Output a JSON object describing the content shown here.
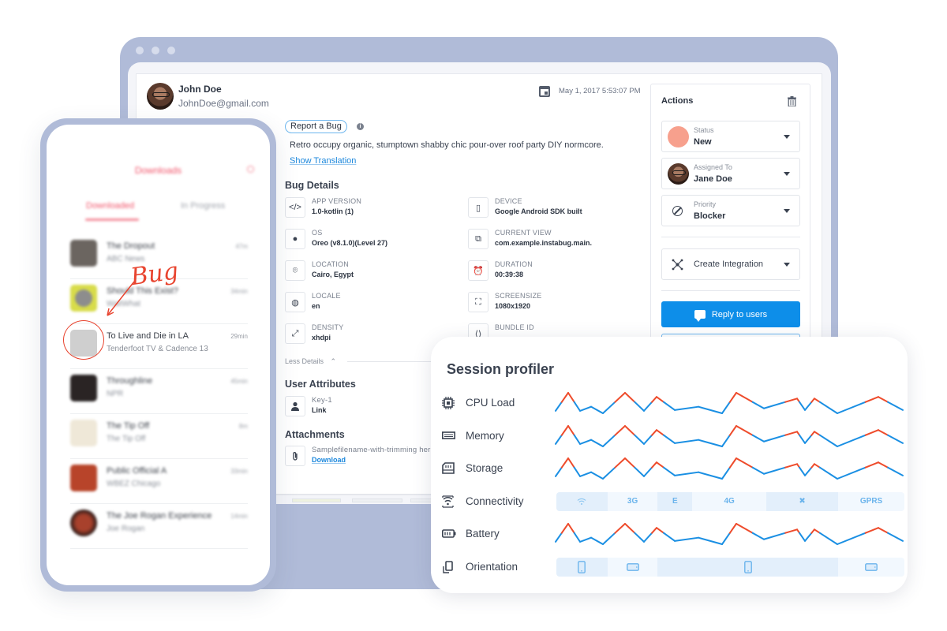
{
  "report": {
    "reporter_name": "John Doe",
    "reporter_email": "JohnDoe@gmail.com",
    "date": "May 1, 2017 5:53:07 PM",
    "category_badge": "Report a Bug",
    "info_glyph": "i",
    "description": "Retro occupy organic, stumptown shabby chic pour-over roof party DIY normcore.",
    "show_translation": "Show Translation"
  },
  "bug_details": {
    "title": "Bug Details",
    "items": [
      {
        "icon": "code-icon",
        "glyph": "</>",
        "label": "APP VERSION",
        "value": "1.0-kotlin (1)"
      },
      {
        "icon": "device-icon",
        "glyph": "▯",
        "label": "DEVICE",
        "value": "Google Android SDK built"
      },
      {
        "icon": "android-icon",
        "glyph": "●",
        "label": "OS",
        "value": "Oreo (v8.1.0)(Level 27)"
      },
      {
        "icon": "current-view-icon",
        "glyph": "⧉",
        "label": "CURRENT VIEW",
        "value": "com.example.instabug.main."
      },
      {
        "icon": "location-icon",
        "glyph": "⌾",
        "label": "LOCATION",
        "value": "Cairo, Egypt"
      },
      {
        "icon": "alarm-clock-icon",
        "glyph": "⏰",
        "label": "DURATION",
        "value": "00:39:38"
      },
      {
        "icon": "globe-icon",
        "glyph": "◍",
        "label": "LOCALE",
        "value": "en"
      },
      {
        "icon": "screensize-icon",
        "glyph": "⛶",
        "label": "SCREENSIZE",
        "value": "1080x1920"
      },
      {
        "icon": "density-icon",
        "glyph": "⤢",
        "label": "DENSITY",
        "value": "xhdpi"
      },
      {
        "icon": "bundle-icon",
        "glyph": "⟨⟩",
        "label": "BUNDLE ID",
        "value": ""
      }
    ],
    "less_details": "Less Details",
    "less_glyph": "⌃"
  },
  "user_attributes": {
    "title": "User Attributes",
    "items": [
      {
        "label": "Key-1",
        "value": "Link"
      }
    ]
  },
  "attachments": {
    "title": "Attachments",
    "items": [
      {
        "filename": "Samplefilename-with-trimming her",
        "action": "Download"
      }
    ]
  },
  "actions": {
    "title": "Actions",
    "status": {
      "label": "Status",
      "value": "New",
      "color": "#f7a08d"
    },
    "assigned_to": {
      "label": "Assigned To",
      "value": "Jane Doe"
    },
    "priority": {
      "label": "Priority",
      "value": "Blocker"
    },
    "integration": "Create Integration",
    "reply": "Reply to users"
  },
  "phone": {
    "title": "Downloads",
    "tabs": [
      "Downloaded",
      "In Progress"
    ],
    "items": [
      {
        "title": "The Dropout",
        "subtitle": "ABC News",
        "duration": "47m",
        "blurred": true
      },
      {
        "title": "Should This Exist?",
        "subtitle": "WaitWhat",
        "duration": "34min",
        "blurred": true
      },
      {
        "title": "To Live and Die in LA",
        "subtitle": "Tenderfoot TV & Cadence 13",
        "duration": "29min",
        "blurred": false
      },
      {
        "title": "Throughline",
        "subtitle": "NPR",
        "duration": "45min",
        "blurred": true
      },
      {
        "title": "The Tip Off",
        "subtitle": "The Tip Off",
        "duration": "8m",
        "blurred": true
      },
      {
        "title": "Public Official A",
        "subtitle": "WBEZ Chicago",
        "duration": "33min",
        "blurred": true
      },
      {
        "title": "The Joe Rogan Experience",
        "subtitle": "Joe Rogan",
        "duration": "14min",
        "blurred": true
      }
    ],
    "annotation": "Bug"
  },
  "profiler": {
    "title": "Session profiler",
    "line_colors": {
      "high": "#ee4b2b",
      "normal": "#1a8fe3"
    },
    "series_levels": [
      0.12,
      1.0,
      0.12,
      0.32,
      0.0,
      1.0,
      0.12,
      0.8,
      0.16,
      0.32,
      0.0,
      1.0,
      0.24,
      0.72,
      0.16,
      0.72,
      0.0,
      0.8,
      0.16
    ],
    "rows": [
      {
        "label": "CPU Load",
        "icon": "cpu-icon",
        "type": "line"
      },
      {
        "label": "Memory",
        "icon": "memory-icon",
        "type": "line"
      },
      {
        "label": "Storage",
        "icon": "storage-icon",
        "type": "line"
      },
      {
        "label": "Connectivity",
        "icon": "connectivity-icon",
        "type": "segments",
        "segments": [
          {
            "label": "wifi",
            "glyph": "wifi-icon",
            "share": 0.147,
            "tone": "dark"
          },
          {
            "label": "3G",
            "share": 0.144,
            "tone": "light"
          },
          {
            "label": "E",
            "share": 0.1,
            "tone": "dark"
          },
          {
            "label": "4G",
            "share": 0.212,
            "tone": "light"
          },
          {
            "label": "✖",
            "glyph": "no-connection-icon",
            "share": 0.207,
            "tone": "dark"
          },
          {
            "label": "GPRS",
            "share": 0.19,
            "tone": "light"
          }
        ]
      },
      {
        "label": "Battery",
        "icon": "battery-icon",
        "type": "line"
      },
      {
        "label": "Orientation",
        "icon": "orientation-icon",
        "type": "segments",
        "segments": [
          {
            "label": "portrait",
            "glyph": "portrait-icon",
            "share": 0.147,
            "tone": "dark"
          },
          {
            "label": "landscape",
            "glyph": "landscape-icon",
            "share": 0.144,
            "tone": "light"
          },
          {
            "label": "portrait",
            "glyph": "portrait-icon",
            "share": 0.519,
            "tone": "dark"
          },
          {
            "label": "landscape",
            "glyph": "landscape-icon",
            "share": 0.19,
            "tone": "light"
          }
        ]
      }
    ]
  }
}
